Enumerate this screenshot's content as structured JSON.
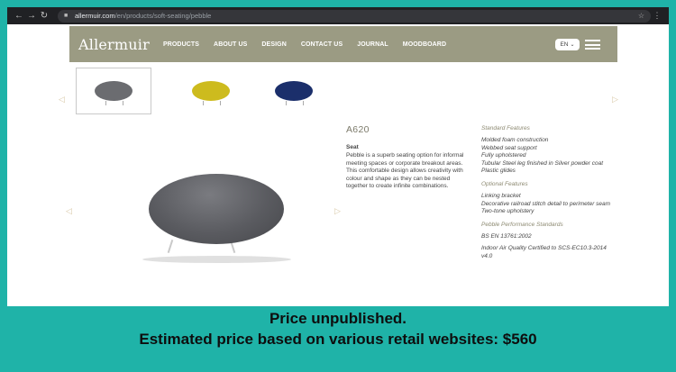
{
  "browser": {
    "url_host": "allermuir.com",
    "url_path": "/en/products/soft-seating/pebble",
    "back_icon": "arrow-left-icon",
    "forward_icon": "arrow-right-icon",
    "reload_icon": "reload-icon"
  },
  "header": {
    "logo": "Allermuir",
    "nav": [
      "PRODUCTS",
      "ABOUT US",
      "DESIGN",
      "CONTACT US",
      "JOURNAL",
      "MOODBOARD"
    ],
    "language": "EN"
  },
  "thumbnails": [
    {
      "color_name": "grey",
      "color": "#6b6c70",
      "selected": true
    },
    {
      "color_name": "yellow",
      "color": "#cdbb1e",
      "selected": false
    },
    {
      "color_name": "navy",
      "color": "#1b2f6b",
      "selected": false
    }
  ],
  "product": {
    "code": "A620",
    "type": "Seat",
    "description": "Pebble is a superb seating option for informal meeting spaces or corporate breakout areas. This comfortable design allows creativity with colour and shape as they can be nested together to create infinite combinations."
  },
  "features": {
    "standard_heading": "Standard Features",
    "standard": [
      "Molded foam construction",
      "Webbed seat support",
      "Fully upholstered",
      "Tubular Steel leg finished in Silver powder coat",
      "Plastic glides"
    ],
    "optional_heading": "Optional Features",
    "optional": [
      "Linking bracket",
      "Decorative railroad stitch detail to perimeter seam",
      "Two-tone upholstery"
    ],
    "performance_heading": "Pebble Performance Standards",
    "performance": [
      "BS EN 13761:2002",
      "Indoor Air Quality Certified to SCS-EC10.3-2014 v4.0"
    ]
  },
  "caption": {
    "line1": "Price unpublished.",
    "line2": "Estimated price based on various retail websites: $560"
  }
}
